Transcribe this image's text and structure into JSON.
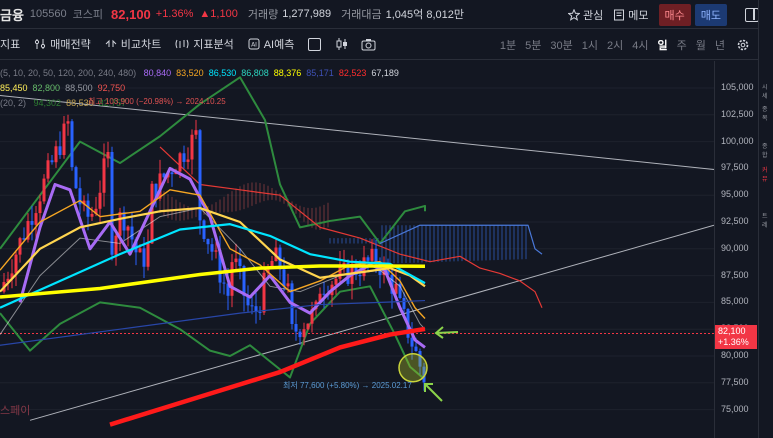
{
  "header": {
    "name": "금융",
    "code": "105560",
    "market": "코스피",
    "price": "82,100",
    "pct": "+1.36%",
    "change": "1,100",
    "volume_label": "거래량",
    "volume": "1,277,989",
    "amount_label": "거래대금",
    "amount": "1,045억 8,012만",
    "watch_label": "관심",
    "memo_label": "메모",
    "buy_label": "매수",
    "sell_label": "매도"
  },
  "toolbar": {
    "indicators_label": "지표",
    "strategy_label": "매매전략",
    "compare_label": "비교차트",
    "analysis_label": "지표분석",
    "ai_label": "AI예측",
    "timeframes": [
      "1분",
      "5분",
      "30분",
      "1시",
      "2시",
      "4시",
      "일",
      "주",
      "월",
      "년"
    ],
    "active_timeframe": "일"
  },
  "legend": {
    "ma_params": "(5, 10, 20, 50, 120, 200, 240, 480)",
    "ma_values": [
      {
        "v": "80,840",
        "c": "#a86bf5"
      },
      {
        "v": "83,520",
        "c": "#f5a623"
      },
      {
        "v": "86,530",
        "c": "#00e5ff"
      },
      {
        "v": "86,808",
        "c": "#2dd4bf"
      },
      {
        "v": "88,376",
        "c": "#ffff00"
      },
      {
        "v": "85,171",
        "c": "#3f51b5"
      },
      {
        "v": "82,523",
        "c": "#ff2d2d"
      },
      {
        "v": "67,189",
        "c": "#d1d4dc"
      }
    ],
    "ichimoku_values": [
      {
        "v": "85,450",
        "c": "#ffee58"
      },
      {
        "v": "82,800",
        "c": "#66bb6a"
      },
      {
        "v": "88,500",
        "c": "#9598a1"
      },
      {
        "v": "92,750",
        "c": "#ef5350"
      }
    ],
    "bb_params": "(20, 2)",
    "bb_values": [
      {
        "v": "94,302",
        "c": "#2e7d32"
      },
      {
        "v": "88,530",
        "c": "#c0a050"
      },
      {
        "v": "82,757",
        "c": "#2e7d32"
      }
    ]
  },
  "annotations": {
    "high": "최고 103,900 (−20.98%) → 2024.10.25",
    "low": "최저 77,600 (+5.80%) → 2025.02.17",
    "watermark": "스페이"
  },
  "price_axis": {
    "ticks": [
      "105,000",
      "102,500",
      "100,000",
      "97,500",
      "95,000",
      "92,500",
      "90,000",
      "87,500",
      "85,000",
      "82,500",
      "80,000",
      "77,500",
      "75,000"
    ],
    "current_price": "82,100",
    "current_pct": "+1.36%"
  },
  "side_labels": [
    "시세",
    "종목",
    "종합",
    "커뮤",
    "트레"
  ],
  "colors": {
    "up": "#f23645",
    "down": "#2962ff",
    "background": "#131722"
  }
}
